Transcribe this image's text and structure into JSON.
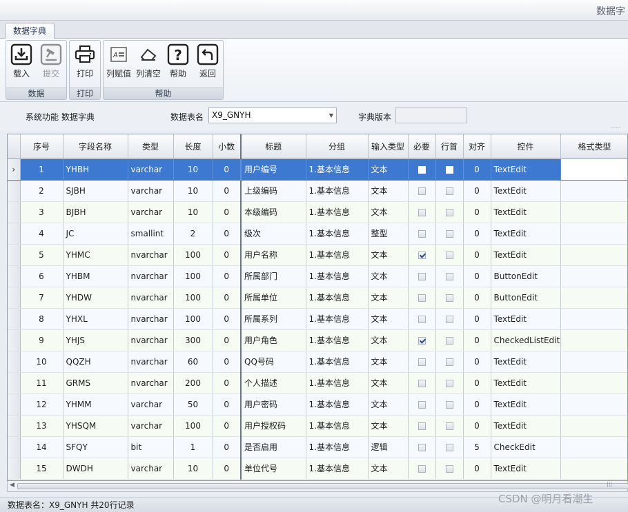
{
  "window": {
    "title": "数据字"
  },
  "tabs": [
    {
      "label": "数据字典"
    }
  ],
  "ribbon": {
    "groups": [
      {
        "caption": "数据",
        "buttons": [
          {
            "label": "载入",
            "icon": "import-icon"
          },
          {
            "label": "提交",
            "icon": "submit-icon"
          }
        ]
      },
      {
        "caption": "打印",
        "buttons": [
          {
            "label": "打印",
            "icon": "printer-icon"
          }
        ]
      },
      {
        "caption": "帮助",
        "buttons": [
          {
            "label": "列赋值",
            "icon": "column-assign-icon"
          },
          {
            "label": "列清空",
            "icon": "eraser-icon"
          },
          {
            "label": "帮助",
            "icon": "help-icon"
          },
          {
            "label": "返回",
            "icon": "return-icon"
          }
        ]
      }
    ]
  },
  "infobar": {
    "system_label": "系统功能",
    "system_value": "数据字典",
    "table_label": "数据表名",
    "table_value": "X9_GNYH",
    "version_label": "字典版本",
    "version_value": ""
  },
  "grid": {
    "columns": [
      "序号",
      "字段名称",
      "类型",
      "长度",
      "小数",
      "标题",
      "分组",
      "输入类型",
      "必要",
      "行首",
      "对齐",
      "控件",
      "格式类型"
    ],
    "selected_row": 0,
    "rows": [
      {
        "no": "1",
        "field": "YHBH",
        "type": "varchar",
        "length": "10",
        "decimals": "0",
        "title": "用户编号",
        "group": "1.基本信息",
        "input_type": "文本",
        "required": false,
        "row_head": false,
        "align": "0",
        "control": "TextEdit",
        "format": ""
      },
      {
        "no": "2",
        "field": "SJBH",
        "type": "varchar",
        "length": "10",
        "decimals": "0",
        "title": "上级编码",
        "group": "1.基本信息",
        "input_type": "文本",
        "required": false,
        "row_head": false,
        "align": "0",
        "control": "TextEdit",
        "format": ""
      },
      {
        "no": "3",
        "field": "BJBH",
        "type": "varchar",
        "length": "10",
        "decimals": "0",
        "title": "本级编码",
        "group": "1.基本信息",
        "input_type": "文本",
        "required": false,
        "row_head": false,
        "align": "0",
        "control": "TextEdit",
        "format": ""
      },
      {
        "no": "4",
        "field": "JC",
        "type": "smallint",
        "length": "2",
        "decimals": "0",
        "title": "级次",
        "group": "1.基本信息",
        "input_type": "整型",
        "required": false,
        "row_head": false,
        "align": "0",
        "control": "TextEdit",
        "format": ""
      },
      {
        "no": "5",
        "field": "YHMC",
        "type": "nvarchar",
        "length": "100",
        "decimals": "0",
        "title": "用户名称",
        "group": "1.基本信息",
        "input_type": "文本",
        "required": true,
        "row_head": false,
        "align": "0",
        "control": "TextEdit",
        "format": ""
      },
      {
        "no": "6",
        "field": "YHBM",
        "type": "nvarchar",
        "length": "100",
        "decimals": "0",
        "title": "所属部门",
        "group": "1.基本信息",
        "input_type": "文本",
        "required": false,
        "row_head": false,
        "align": "0",
        "control": "ButtonEdit",
        "format": ""
      },
      {
        "no": "7",
        "field": "YHDW",
        "type": "nvarchar",
        "length": "100",
        "decimals": "0",
        "title": "所属单位",
        "group": "1.基本信息",
        "input_type": "文本",
        "required": false,
        "row_head": false,
        "align": "0",
        "control": "ButtonEdit",
        "format": ""
      },
      {
        "no": "8",
        "field": "YHXL",
        "type": "nvarchar",
        "length": "100",
        "decimals": "0",
        "title": "所属系列",
        "group": "1.基本信息",
        "input_type": "文本",
        "required": false,
        "row_head": false,
        "align": "0",
        "control": "TextEdit",
        "format": ""
      },
      {
        "no": "9",
        "field": "YHJS",
        "type": "nvarchar",
        "length": "300",
        "decimals": "0",
        "title": "用户角色",
        "group": "1.基本信息",
        "input_type": "文本",
        "required": true,
        "row_head": false,
        "align": "0",
        "control": "CheckedListEdit",
        "format": ""
      },
      {
        "no": "10",
        "field": "QQZH",
        "type": "nvarchar",
        "length": "60",
        "decimals": "0",
        "title": "QQ号码",
        "group": "1.基本信息",
        "input_type": "文本",
        "required": false,
        "row_head": false,
        "align": "0",
        "control": "TextEdit",
        "format": ""
      },
      {
        "no": "11",
        "field": "GRMS",
        "type": "nvarchar",
        "length": "200",
        "decimals": "0",
        "title": "个人描述",
        "group": "1.基本信息",
        "input_type": "文本",
        "required": false,
        "row_head": false,
        "align": "0",
        "control": "TextEdit",
        "format": ""
      },
      {
        "no": "12",
        "field": "YHMM",
        "type": "varchar",
        "length": "50",
        "decimals": "0",
        "title": "用户密码",
        "group": "1.基本信息",
        "input_type": "文本",
        "required": false,
        "row_head": false,
        "align": "0",
        "control": "TextEdit",
        "format": ""
      },
      {
        "no": "13",
        "field": "YHSQM",
        "type": "varchar",
        "length": "100",
        "decimals": "0",
        "title": "用户授权码",
        "group": "1.基本信息",
        "input_type": "文本",
        "required": false,
        "row_head": false,
        "align": "0",
        "control": "TextEdit",
        "format": ""
      },
      {
        "no": "14",
        "field": "SFQY",
        "type": "bit",
        "length": "1",
        "decimals": "0",
        "title": "是否启用",
        "group": "1.基本信息",
        "input_type": "逻辑",
        "required": false,
        "row_head": false,
        "align": "5",
        "control": "CheckEdit",
        "format": ""
      },
      {
        "no": "15",
        "field": "DWDH",
        "type": "varchar",
        "length": "10",
        "decimals": "0",
        "title": "单位代号",
        "group": "1.基本信息",
        "input_type": "文本",
        "required": false,
        "row_head": false,
        "align": "0",
        "control": "TextEdit",
        "format": ""
      }
    ]
  },
  "status": {
    "text": "数据表名：X9_GNYH 共20行记录"
  },
  "watermark": {
    "text": "CSDN @明月看潮生"
  }
}
